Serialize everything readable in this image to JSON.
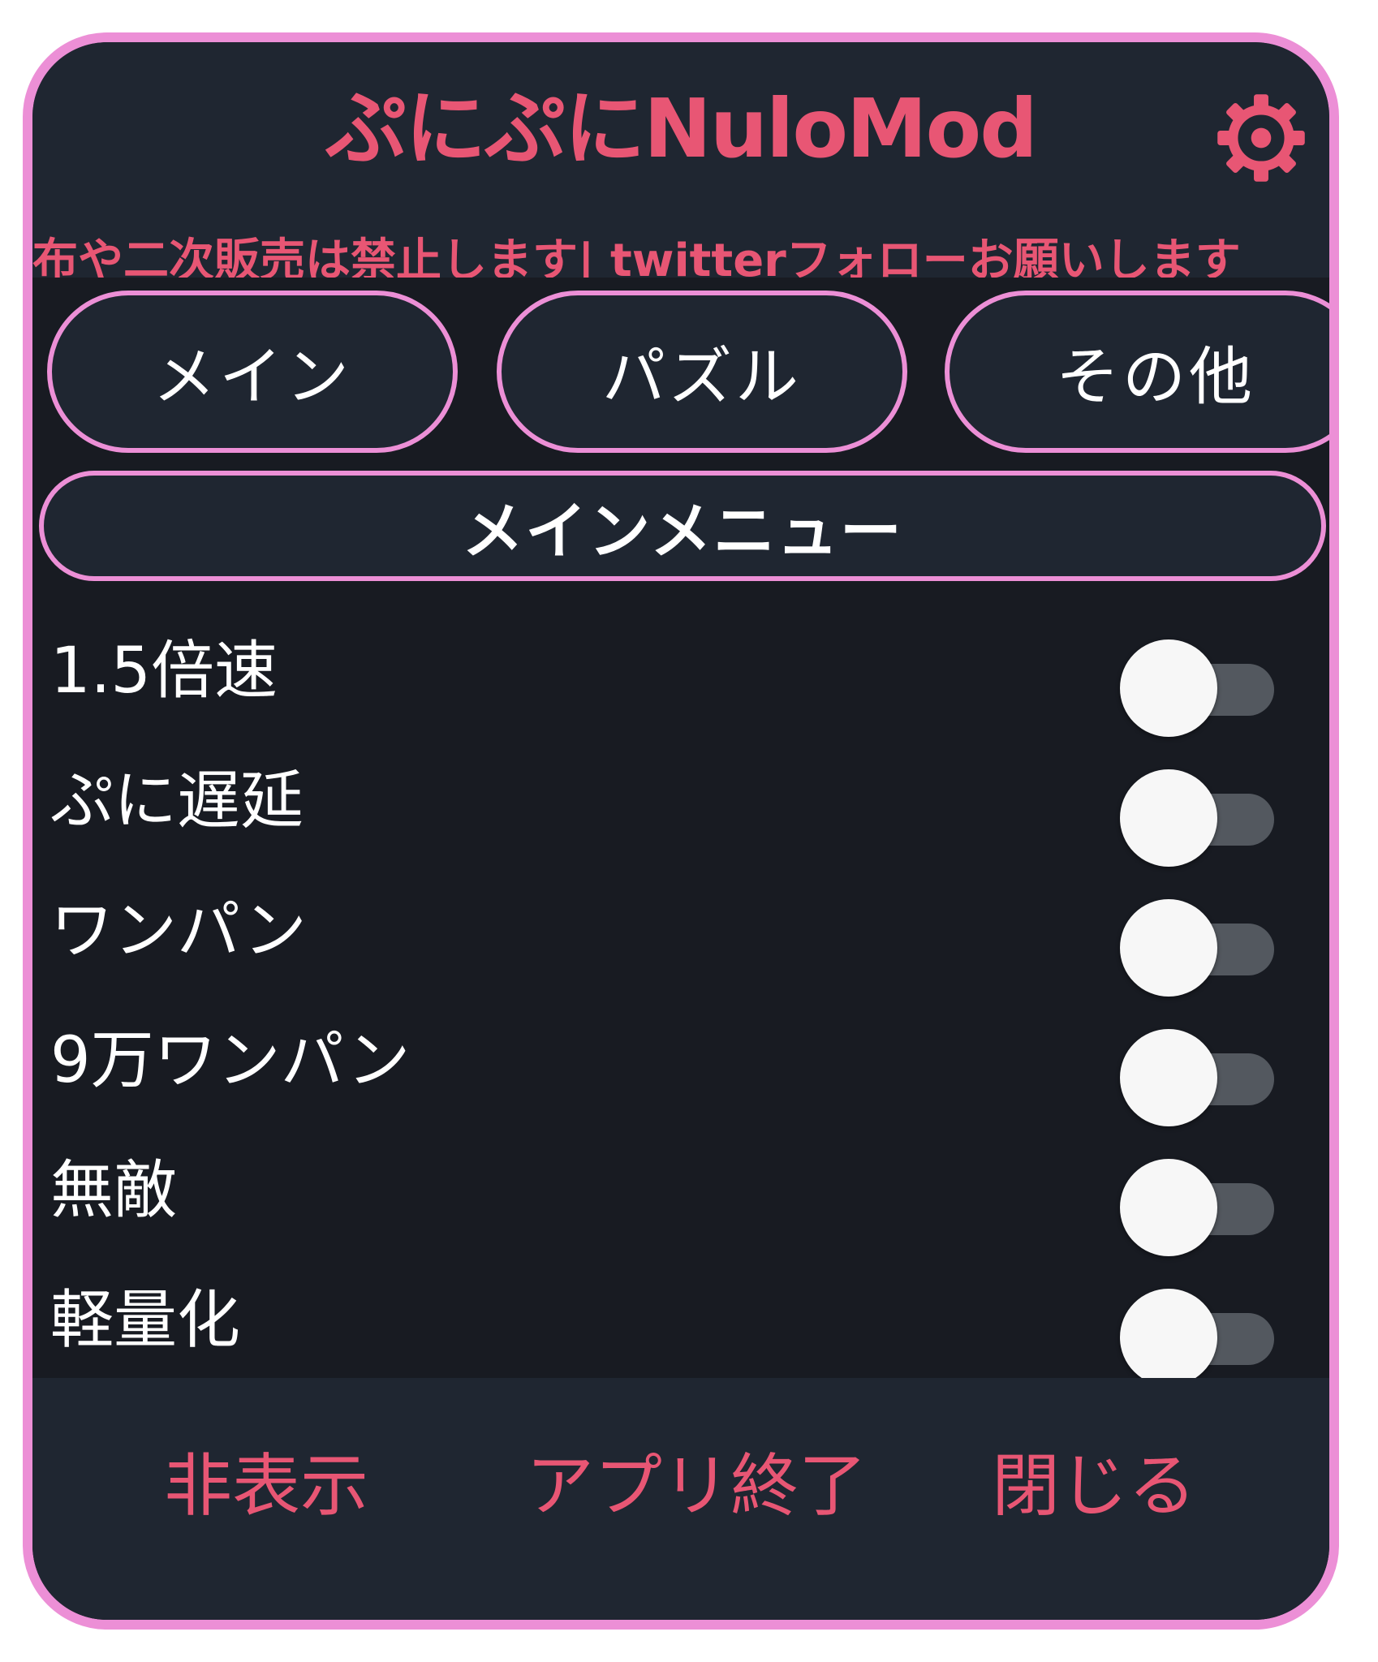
{
  "app": {
    "title": "ぷにぷにNuloMod",
    "settings_icon": "gear-icon",
    "marquee": "配布や二次販売は禁止します| twitterフォローお願いします"
  },
  "tabs": [
    {
      "label": "メイン"
    },
    {
      "label": "パズル"
    },
    {
      "label": "その他"
    }
  ],
  "section": {
    "title": "メインメニュー"
  },
  "toggles": [
    {
      "label": "1.5倍速",
      "enabled": false
    },
    {
      "label": "ぷに遅延",
      "enabled": false
    },
    {
      "label": "ワンパン",
      "enabled": false
    },
    {
      "label": "9万ワンパン",
      "enabled": false
    },
    {
      "label": "無敵",
      "enabled": false
    },
    {
      "label": "軽量化",
      "enabled": false
    }
  ],
  "footer": {
    "hide_label": "非表示",
    "quit_label": "アプリ終了",
    "close_label": "閉じる"
  },
  "colors": {
    "accent_pink": "#ec8fd6",
    "text_red": "#e85674",
    "panel": "#1f2631",
    "background": "#181b22"
  }
}
